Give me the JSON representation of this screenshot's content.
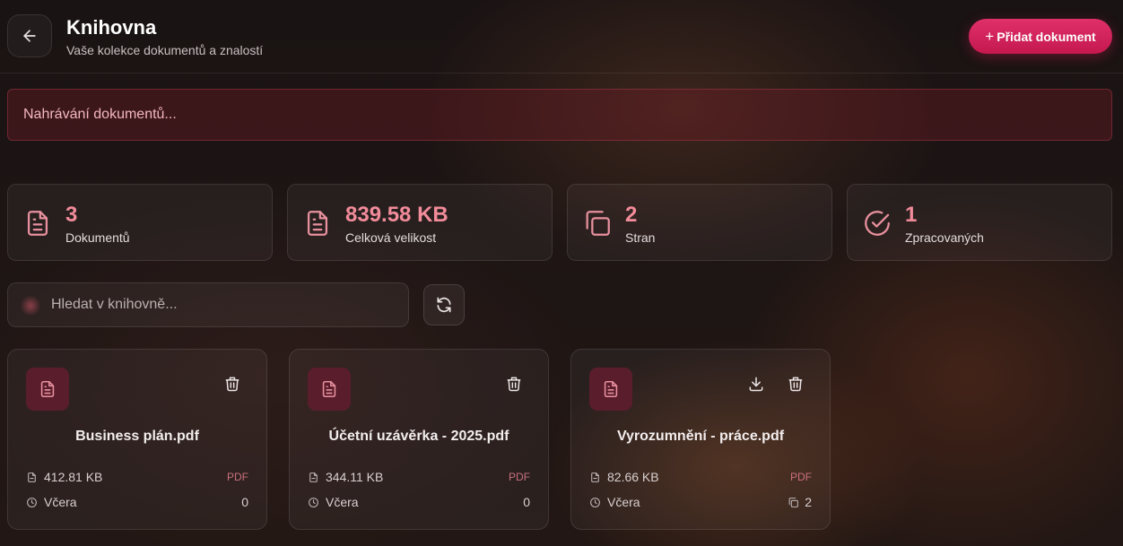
{
  "header": {
    "title": "Knihovna",
    "subtitle": "Vaše kolekce dokumentů a znalostí",
    "add_button_label": "Přidat dokument",
    "back_icon": "arrow-left-icon",
    "add_icon": "plus-icon"
  },
  "upload_status": "Nahrávání dokumentů...",
  "stats": [
    {
      "value": "3",
      "label": "Dokumentů",
      "icon": "document-icon"
    },
    {
      "value": "839.58 KB",
      "label": "Celková velikost",
      "icon": "document-icon"
    },
    {
      "value": "2",
      "label": "Stran",
      "icon": "pages-copy-icon"
    },
    {
      "value": "1",
      "label": "Zpracovaných",
      "icon": "check-circle-icon"
    }
  ],
  "search": {
    "placeholder": "Hledat v knihovně..."
  },
  "documents": [
    {
      "name": "Business plán.pdf",
      "size": "412.81 KB",
      "type": "PDF",
      "date": "Včera",
      "pages": "0",
      "downloadable": false
    },
    {
      "name": "Účetní uzávěrka - 2025.pdf",
      "size": "344.11 KB",
      "type": "PDF",
      "date": "Včera",
      "pages": "0",
      "downloadable": false
    },
    {
      "name": "Vyrozumnění - práce.pdf",
      "size": "82.66 KB",
      "type": "PDF",
      "date": "Včera",
      "pages": "2",
      "downloadable": true
    }
  ],
  "colors": {
    "accent": "#e0306a",
    "stat_value": "#f28b9a",
    "icon_tint": "#e8909e",
    "file_type": "#c9707e",
    "upload_text": "#f4b7bf"
  }
}
